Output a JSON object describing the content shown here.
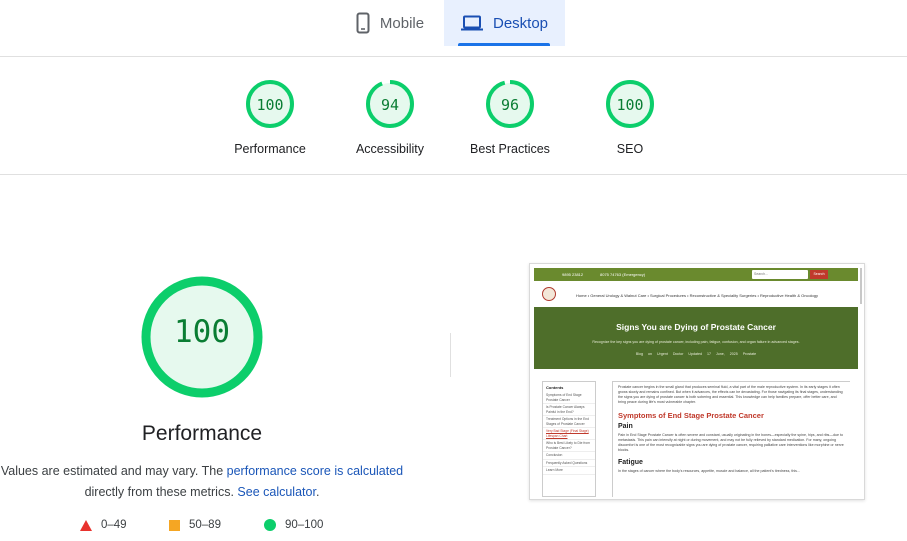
{
  "tabs": [
    {
      "label": "Mobile",
      "icon": "smartphone-icon",
      "selected": false
    },
    {
      "label": "Desktop",
      "icon": "laptop-icon",
      "selected": true
    }
  ],
  "categories": [
    {
      "label": "Performance",
      "score": "100",
      "fraction": 1.0
    },
    {
      "label": "Accessibility",
      "score": "94",
      "fraction": 0.94
    },
    {
      "label": "Best Practices",
      "score": "96",
      "fraction": 0.96
    },
    {
      "label": "SEO",
      "score": "100",
      "fraction": 1.0
    }
  ],
  "main": {
    "score": "100",
    "score_fraction": 1.0,
    "title": "Performance",
    "note_prefix": "Values are estimated and may vary. The ",
    "note_link1": "performance score is calculated",
    "note_middle": " directly from these metrics. ",
    "note_link2": "See calculator",
    "note_suffix": "."
  },
  "legend": [
    {
      "range": "0–49",
      "shape": "triangle",
      "color": "#e8322d"
    },
    {
      "range": "50–89",
      "shape": "square",
      "color": "#f5a623"
    },
    {
      "range": "90–100",
      "shape": "circle",
      "color": "#0cce6b"
    }
  ],
  "colors": {
    "pass": "#0cce6b",
    "pass_text": "#0a7d33",
    "pass_bg": "#e6f9ee",
    "accent": "#1a73e8"
  },
  "thumbnail": {
    "phone": "9895 23812",
    "emergency": "8075 74763 (Emergency)",
    "search_placeholder": "Search...",
    "search_button": "Search",
    "nav": "Home  •  General Urology & Walnut Care  •  Surgical Procedures  •  Reconstructive & Speciality Surgeries  •  Reproductive Health & Oncology",
    "hero_title": "Signs You are Dying of Prostate Cancer",
    "hero_sub": "Recognize the key signs you are dying of prostate cancer, including pain, fatigue, confusion, and organ failure in advanced stages.",
    "hero_meta": "Blog on Urgent Doctor   Updated 17 June, 2025   Prostate",
    "toc_title": "Contents",
    "toc_items": [
      "Symptoms of End Stage Prostate Cancer",
      "Is Prostate Cancer Always Painful in the End?",
      "Treatment Options in the End Stages of Prostate Cancer",
      "Very Bad Stage (Final Stage) Lifespan Chart",
      "Who is Best Likely to Die from Prostate Cancer?",
      "Conclusion",
      "Frequently Asked Questions",
      "Learn More"
    ],
    "intro": "Prostate cancer begins in the small gland that produces seminal fluid, a vital part of the male reproductive system. In its early stages it often grows slowly and remains confined. But when it advances, the effects can be devastating. For those navigating its final stages, understanding the signs you are dying of prostate cancer is both sobering and essential. This knowledge can help families prepare, offer better care, and bring peace during life's most vulnerable chapter.",
    "h2": "Symptoms of End Stage Prostate Cancer",
    "h3_pain": "Pain",
    "pain_text": "Pain in End Stage Prostate Cancer is often severe and constant, usually originating in the bones—especially the spine, hips, and ribs—due to metastasis. This pain can intensify at night or during movement, and may not be fully relieved by standard medication. For many, ongoing discomfort is one of the most recognizable signs you are dying of prostate cancer, requiring palliative care interventions like morphine or nerve blocks.",
    "h3_fatigue": "Fatigue",
    "fatigue_text": "In the stages of cancer where the body's resources, appetite, muscle and balance, all the patient's tiredness, this..."
  }
}
